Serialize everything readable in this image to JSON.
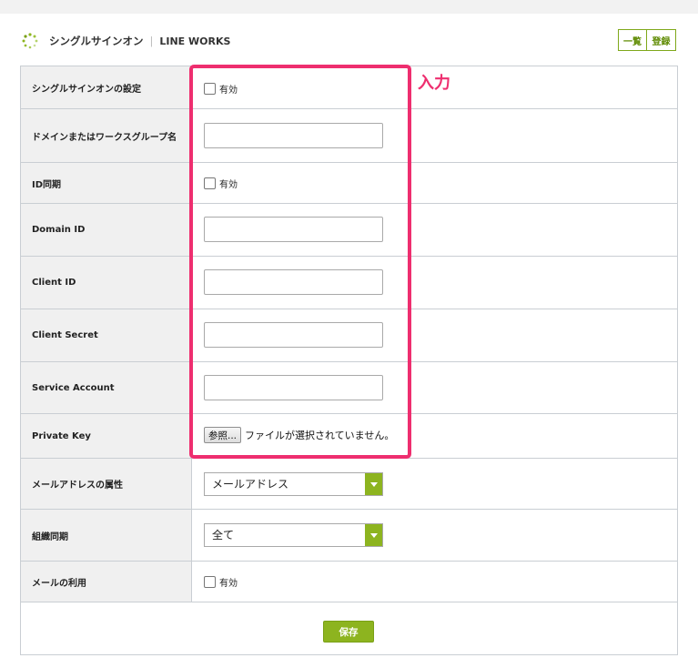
{
  "header": {
    "title": "シングルサインオン",
    "separator": "|",
    "subtitle": "LINE WORKS",
    "buttons": {
      "list": "一覧",
      "register": "登録"
    }
  },
  "form": {
    "rows": [
      {
        "label": "シングルサインオンの設定",
        "type": "checkbox",
        "text": "有効"
      },
      {
        "label": "ドメインまたはワークスグループ名",
        "type": "text",
        "value": ""
      },
      {
        "label": "ID同期",
        "type": "checkbox",
        "text": "有効"
      },
      {
        "label": "Domain ID",
        "type": "text",
        "value": ""
      },
      {
        "label": "Client ID",
        "type": "text",
        "value": ""
      },
      {
        "label": "Client Secret",
        "type": "text",
        "value": ""
      },
      {
        "label": "Service Account",
        "type": "text",
        "value": ""
      },
      {
        "label": "Private Key",
        "type": "file",
        "button": "参照...",
        "text": "ファイルが選択されていません。"
      },
      {
        "label": "メールアドレスの属性",
        "type": "select",
        "value": "メールアドレス"
      },
      {
        "label": "組織同期",
        "type": "select",
        "value": "全て"
      },
      {
        "label": "メールの利用",
        "type": "checkbox",
        "text": "有効"
      }
    ],
    "save_label": "保存"
  },
  "annotation": {
    "label": "入力",
    "color": "#ee2e6f"
  },
  "colors": {
    "accent": "#8db41f",
    "annotation": "#ee2e6f"
  }
}
